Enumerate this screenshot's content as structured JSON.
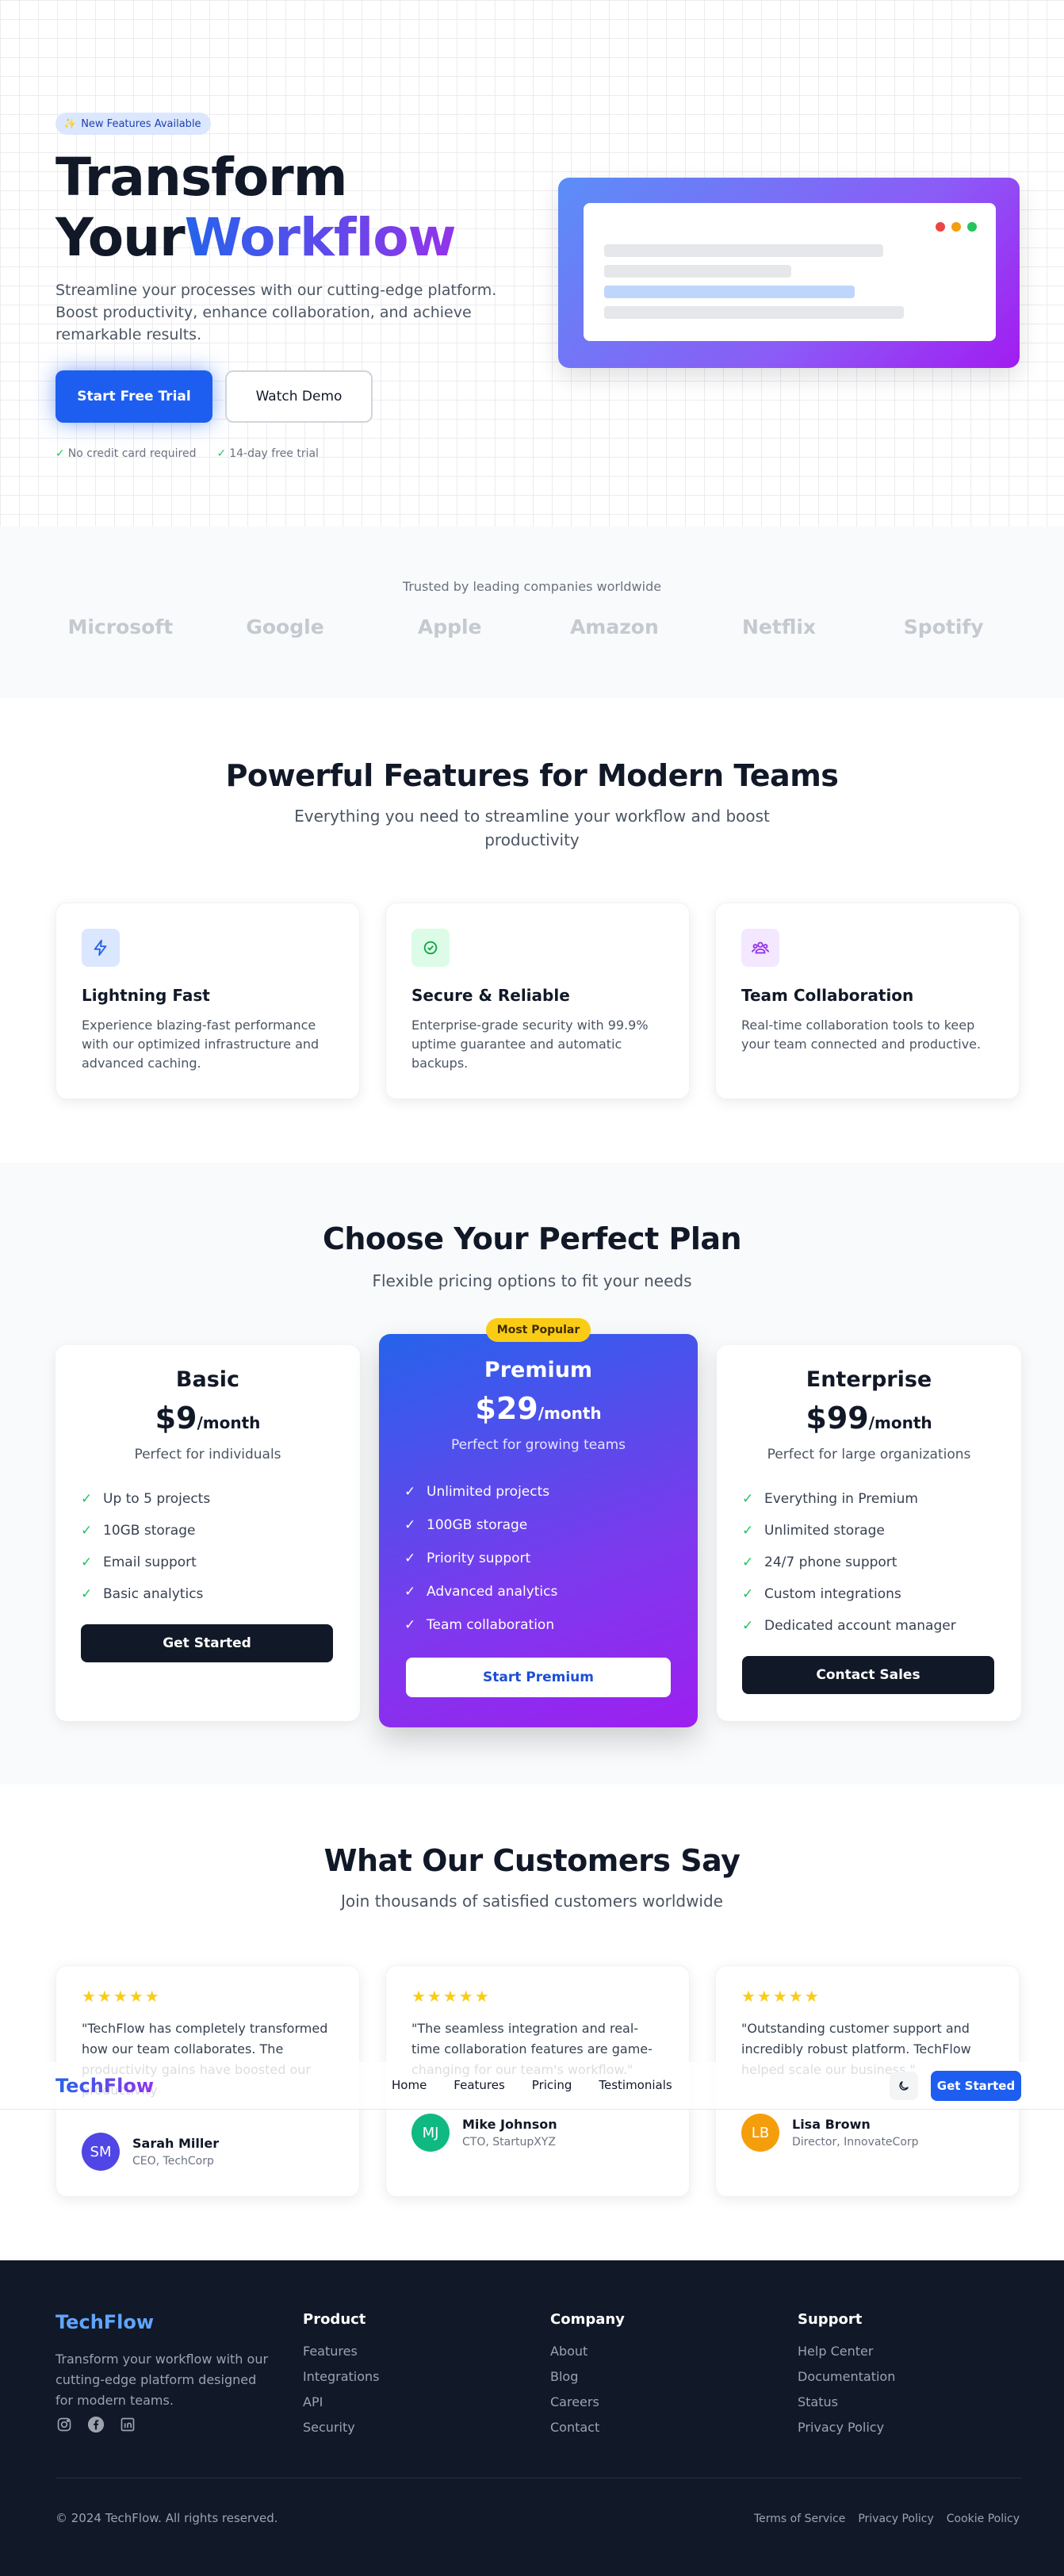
{
  "hero": {
    "badge_icon": "sparkles-icon",
    "badge": "New Features Available",
    "title_line1": "Transform",
    "title_line2_plain": "Your",
    "title_line2_accent": "Workflow",
    "description": "Streamline your processes with our cutting-edge platform. Boost productivity, enhance collaboration, and achieve remarkable results.",
    "primary_cta": "Start Free Trial",
    "secondary_cta": "Watch Demo",
    "checks": [
      "No credit card required",
      "14-day free trial"
    ]
  },
  "trusted": {
    "title": "Trusted by leading companies worldwide",
    "logos": [
      "Microsoft",
      "Google",
      "Apple",
      "Amazon",
      "Netflix",
      "Spotify"
    ]
  },
  "features": {
    "title": "Powerful Features for Modern Teams",
    "subtitle_line1": "Everything you need to streamline your workflow and boost",
    "subtitle_line2": "productivity",
    "items": [
      {
        "icon": "lightning-icon",
        "title": "Lightning Fast",
        "description": "Experience blazing-fast performance with our optimized infrastructure and advanced caching."
      },
      {
        "icon": "shield-check-icon",
        "title": "Secure & Reliable",
        "description": "Enterprise-grade security with 99.9% uptime guarantee and automatic backups."
      },
      {
        "icon": "team-icon",
        "title": "Team Collaboration",
        "description": "Real-time collaboration tools to keep your team connected and productive."
      }
    ]
  },
  "pricing": {
    "title": "Choose Your Perfect Plan",
    "subtitle": "Flexible pricing options to fit your needs",
    "popular_badge": "Most Popular",
    "plans": [
      {
        "name": "Basic",
        "price": "$9",
        "period": "/month",
        "for": "Perfect for individuals",
        "features": [
          "Up to 5 projects",
          "10GB storage",
          "Email support",
          "Basic analytics"
        ],
        "cta": "Get Started"
      },
      {
        "name": "Premium",
        "price": "$29",
        "period": "/month",
        "for": "Perfect for growing teams",
        "features": [
          "Unlimited projects",
          "100GB storage",
          "Priority support",
          "Advanced analytics",
          "Team collaboration"
        ],
        "cta": "Start Premium"
      },
      {
        "name": "Enterprise",
        "price": "$99",
        "period": "/month",
        "for": "Perfect for large organizations",
        "features": [
          "Everything in Premium",
          "Unlimited storage",
          "24/7 phone support",
          "Custom integrations",
          "Dedicated account manager"
        ],
        "cta": "Contact Sales"
      }
    ]
  },
  "testimonials": {
    "title": "What Our Customers Say",
    "subtitle": "Join thousands of satisfied customers worldwide",
    "stars": "★★★★★",
    "items": [
      {
        "quote": "\"TechFlow has completely transformed how our team collaborates. The productivity gains have boosted our productivity",
        "initials": "SM",
        "name": "Sarah Miller",
        "role": "CEO, TechCorp",
        "color": "#4f46e5"
      },
      {
        "quote": "\"The seamless integration and real-time collaboration features are game-changing for our team's workflow.\"",
        "initials": "MJ",
        "name": "Mike Johnson",
        "role": "CTO, StartupXYZ",
        "color": "#10b981"
      },
      {
        "quote": "\"Outstanding customer support and incredibly robust platform. TechFlow helped scale our business.\"",
        "initials": "LB",
        "name": "Lisa Brown",
        "role": "Director, InnovateCorp",
        "color": "#f59e0b"
      }
    ]
  },
  "nav": {
    "logo": "TechFlow",
    "links": [
      "Home",
      "Features",
      "Pricing",
      "Testimonials"
    ],
    "theme_icon": "moon-icon",
    "cta": "Get Started"
  },
  "footer": {
    "logo": "TechFlow",
    "description": "Transform your workflow with our cutting-edge platform designed for modern teams.",
    "social": [
      "instagram-icon",
      "facebook-icon",
      "linkedin-icon"
    ],
    "columns": [
      {
        "title": "Product",
        "links": [
          "Features",
          "Integrations",
          "API",
          "Security"
        ]
      },
      {
        "title": "Company",
        "links": [
          "About",
          "Blog",
          "Careers",
          "Contact"
        ]
      },
      {
        "title": "Support",
        "links": [
          "Help Center",
          "Documentation",
          "Status",
          "Privacy Policy"
        ]
      }
    ],
    "copyright": "© 2024 TechFlow. All rights reserved.",
    "legal": [
      "Terms of Service",
      "Privacy Policy",
      "Cookie Policy"
    ]
  },
  "colors": {
    "brand_blue": "#1d5ef0",
    "brand_purple": "#9333ea",
    "dark": "#111827",
    "success": "#22c55e",
    "star": "#facc15"
  }
}
